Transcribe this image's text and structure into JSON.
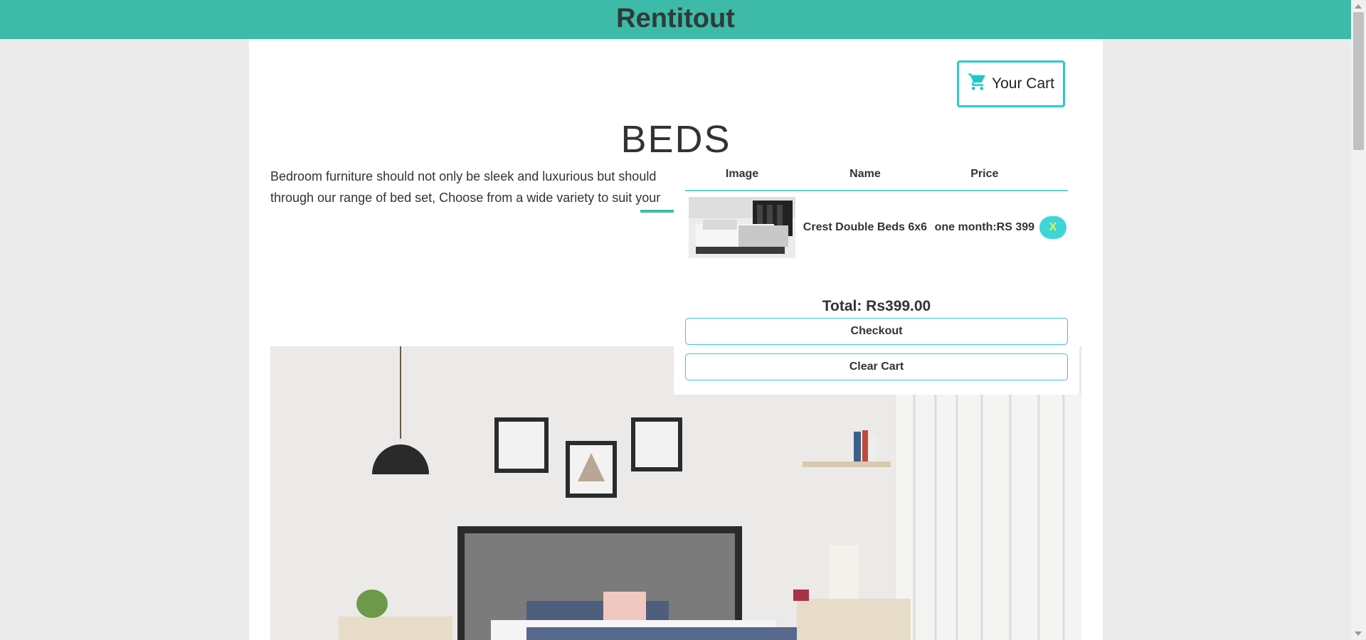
{
  "site": {
    "brand": "Rentitout"
  },
  "header_cart": {
    "label": "Your Cart",
    "icon": "cart-icon"
  },
  "page": {
    "title": "BEDS",
    "description": "Bedroom furniture should not only be sleek and luxurious but should\nthrough our range of bed set, Choose from a wide variety to suit your"
  },
  "cart": {
    "columns": [
      "Image",
      "Name",
      "Price"
    ],
    "items": [
      {
        "name": "Crest Double Beds 6x6",
        "price": "one month:RS 399",
        "remove_label": "X"
      }
    ],
    "total": "Total: Rs399.00",
    "checkout_label": "Checkout",
    "clear_label": "Clear Cart"
  },
  "colors": {
    "header": "#3dbaa8",
    "accent": "#2fc9c9",
    "remove_button": "#3dd6d6"
  }
}
